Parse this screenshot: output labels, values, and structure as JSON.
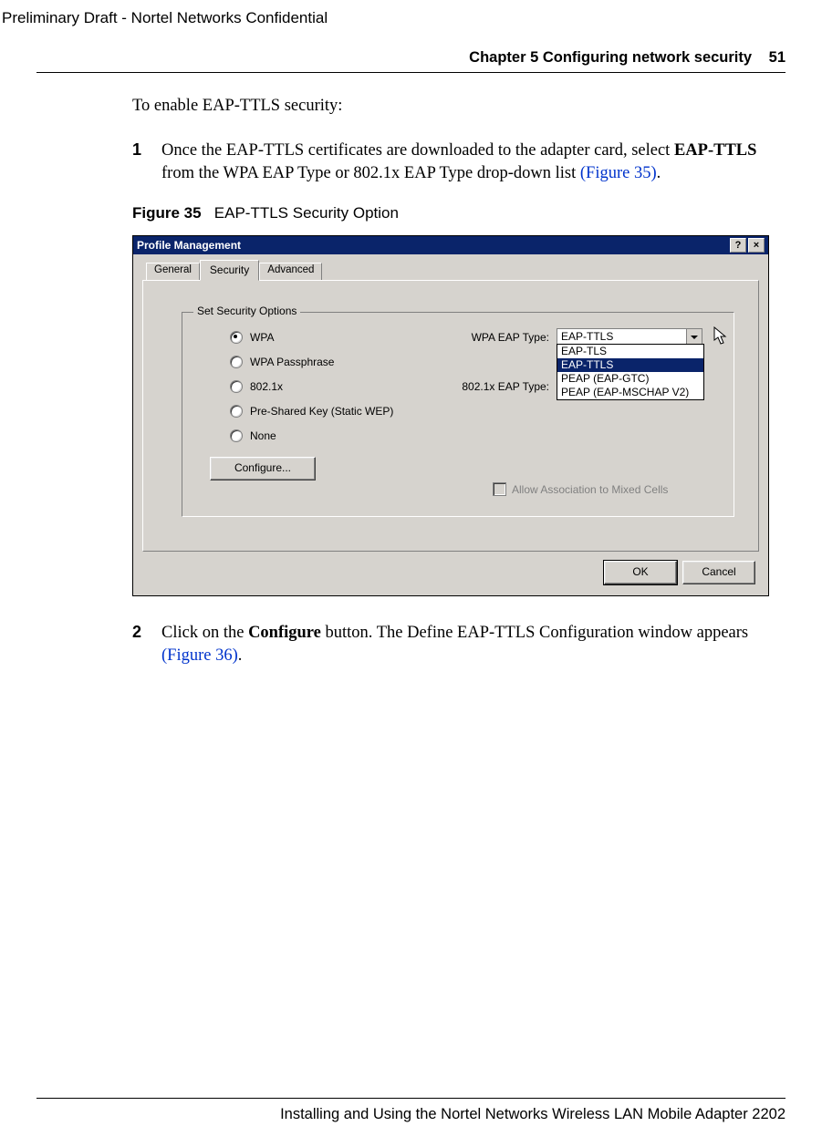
{
  "header": {
    "draft": "Preliminary Draft - Nortel Networks Confidential",
    "chapter": "Chapter 5 Configuring network security",
    "page": "51"
  },
  "intro": "To enable EAP-TTLS security:",
  "steps": {
    "1": {
      "num": "1",
      "before": "Once the EAP-TTLS certificates are downloaded to the adapter card, select ",
      "bold": "EAP-TTLS",
      "after": " from the WPA EAP Type or 802.1x EAP Type drop-down list ",
      "link": "(Figure 35)",
      "end": "."
    },
    "2": {
      "num": "2",
      "before": "Click on the ",
      "bold": "Configure",
      "after": " button. The Define EAP-TTLS Configuration window appears ",
      "link": "(Figure 36)",
      "end": "."
    }
  },
  "figure": {
    "label": "Figure 35",
    "caption": "EAP-TTLS Security Option"
  },
  "dialog": {
    "title": "Profile Management",
    "help": "?",
    "close": "×",
    "tabs": {
      "general": "General",
      "security": "Security",
      "advanced": "Advanced"
    },
    "fieldset_legend": "Set Security Options",
    "radios": {
      "wpa": "WPA",
      "wpa_pass": "WPA Passphrase",
      "x8021": "802.1x",
      "psk": "Pre-Shared Key (Static WEP)",
      "none": "None"
    },
    "labels": {
      "wpa_eap": "WPA EAP Type:",
      "x8021_eap": "802.1x EAP Type:"
    },
    "combo_value": "EAP-TTLS",
    "options": {
      "o0": "EAP-TLS",
      "o1": "EAP-TTLS",
      "o2": "PEAP (EAP-GTC)",
      "o3": "PEAP (EAP-MSCHAP V2)"
    },
    "configure": "Configure...",
    "mixed": "Allow Association to Mixed Cells",
    "ok": "OK",
    "cancel": "Cancel"
  },
  "footer": "Installing and Using the Nortel Networks Wireless LAN Mobile Adapter 2202"
}
